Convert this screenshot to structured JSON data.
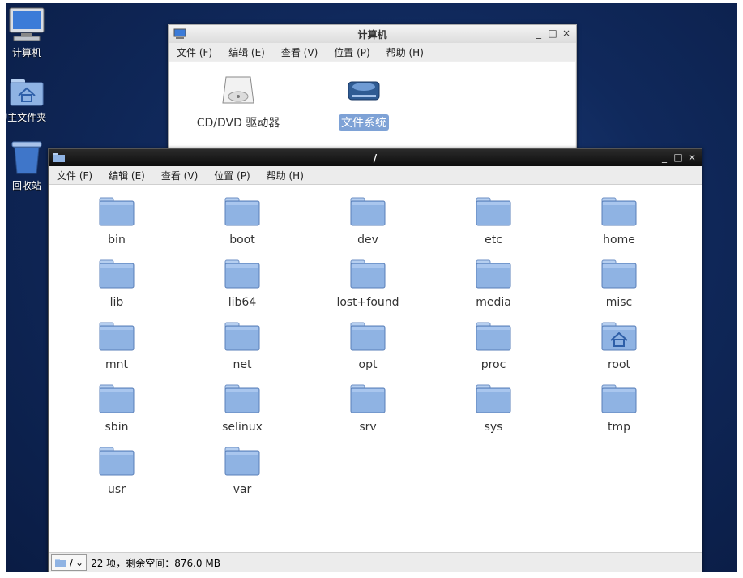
{
  "desktop": {
    "icons": [
      {
        "label": "计算机",
        "icon": "computer-icon"
      },
      {
        "label": "t 的主文件夹",
        "icon": "home-folder-icon"
      },
      {
        "label": "回收站",
        "icon": "trash-icon"
      }
    ]
  },
  "window_computer": {
    "title": "计算机",
    "menu": [
      "文件 (F)",
      "编辑 (E)",
      "查看 (V)",
      "位置 (P)",
      "帮助 (H)"
    ],
    "items": [
      {
        "label": "CD/DVD 驱动器",
        "icon": "optical-drive-icon",
        "selected": false
      },
      {
        "label": "文件系统",
        "icon": "filesystem-icon",
        "selected": true
      }
    ],
    "controls": {
      "minimize": "_",
      "maximize": "□",
      "close": "×"
    }
  },
  "window_root": {
    "title": "/",
    "menu": [
      "文件 (F)",
      "编辑 (E)",
      "查看 (V)",
      "位置 (P)",
      "帮助 (H)"
    ],
    "folders": [
      {
        "name": "bin",
        "special": ""
      },
      {
        "name": "boot",
        "special": ""
      },
      {
        "name": "dev",
        "special": ""
      },
      {
        "name": "etc",
        "special": ""
      },
      {
        "name": "home",
        "special": ""
      },
      {
        "name": "lib",
        "special": ""
      },
      {
        "name": "lib64",
        "special": ""
      },
      {
        "name": "lost+found",
        "special": ""
      },
      {
        "name": "media",
        "special": ""
      },
      {
        "name": "misc",
        "special": ""
      },
      {
        "name": "mnt",
        "special": ""
      },
      {
        "name": "net",
        "special": ""
      },
      {
        "name": "opt",
        "special": ""
      },
      {
        "name": "proc",
        "special": ""
      },
      {
        "name": "root",
        "special": "home"
      },
      {
        "name": "sbin",
        "special": ""
      },
      {
        "name": "selinux",
        "special": ""
      },
      {
        "name": "srv",
        "special": ""
      },
      {
        "name": "sys",
        "special": ""
      },
      {
        "name": "tmp",
        "special": ""
      },
      {
        "name": "usr",
        "special": ""
      },
      {
        "name": "var",
        "special": ""
      }
    ],
    "status": {
      "path_button": "/",
      "text": "22 项，剩余空间：876.0 MB"
    },
    "controls": {
      "minimize": "_",
      "maximize": "□",
      "close": "×"
    }
  },
  "colors": {
    "folder_body": "#8fb3e3",
    "folder_tab": "#b6cff0",
    "selection": "#7ea2d6"
  }
}
